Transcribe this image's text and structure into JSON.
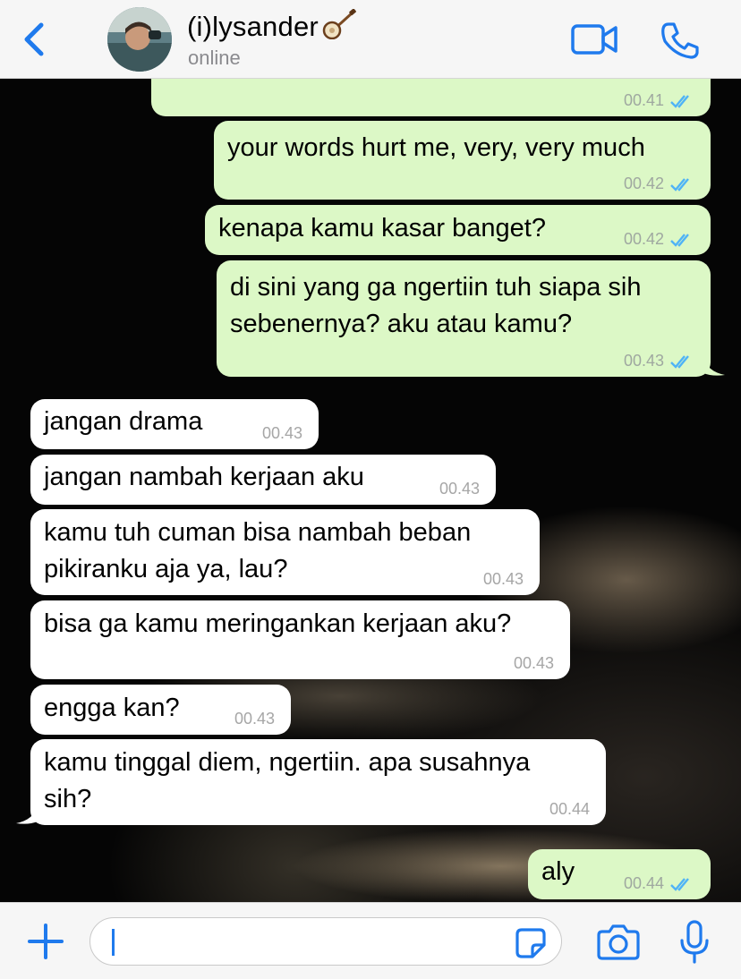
{
  "header": {
    "contact_name": "(i)lysander",
    "contact_status": "online",
    "accent_color": "#1f7aed"
  },
  "messages": [
    {
      "direction": "outgoing",
      "text": "",
      "time": "00.41",
      "status": "read"
    },
    {
      "direction": "outgoing",
      "text": "your words hurt me, very, very much",
      "time": "00.42",
      "status": "read"
    },
    {
      "direction": "outgoing",
      "text": "kenapa kamu kasar banget?",
      "time": "00.42",
      "status": "read"
    },
    {
      "direction": "outgoing",
      "text": "di sini yang ga ngertiin tuh siapa sih\nsebenernya? aku atau kamu?",
      "time": "00.43",
      "status": "read"
    },
    {
      "direction": "incoming",
      "text": "jangan drama",
      "time": "00.43"
    },
    {
      "direction": "incoming",
      "text": "jangan nambah kerjaan aku",
      "time": "00.43"
    },
    {
      "direction": "incoming",
      "text": "kamu tuh cuman bisa nambah beban\npikiranku aja ya, lau?",
      "time": "00.43"
    },
    {
      "direction": "incoming",
      "text": "bisa ga kamu meringankan kerjaan aku?",
      "time": "00.43"
    },
    {
      "direction": "incoming",
      "text": "engga kan?",
      "time": "00.43"
    },
    {
      "direction": "incoming",
      "text": "kamu tinggal diem, ngertiin. apa susahnya\nsih?",
      "time": "00.44"
    },
    {
      "direction": "outgoing",
      "text": "aly",
      "time": "00.44",
      "status": "read"
    }
  ],
  "composer": {
    "value": ""
  },
  "icons": {
    "back": "chevron-left-icon",
    "video": "video-camera-icon",
    "call": "phone-icon",
    "plus": "plus-icon",
    "sticker": "sticker-icon",
    "camera": "camera-icon",
    "mic": "microphone-icon",
    "tick": "double-check-icon"
  },
  "colors": {
    "outgoing_bubble": "#dcf8c6",
    "incoming_bubble": "#ffffff",
    "read_ticks": "#4fb3f6"
  }
}
